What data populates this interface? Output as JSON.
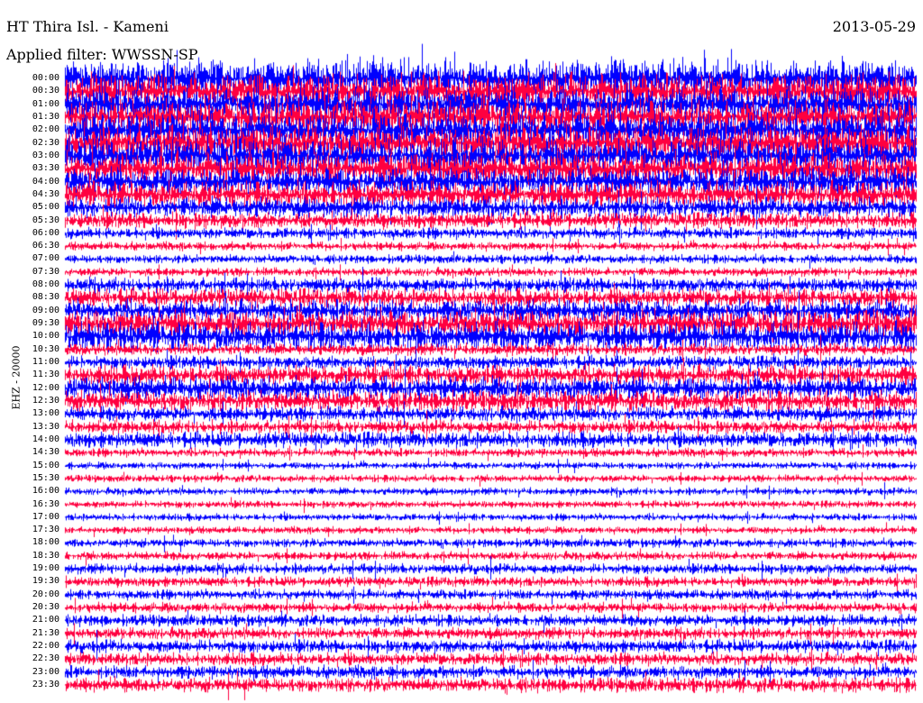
{
  "header": {
    "station": "HT Thira Isl. - Kameni",
    "filter": "Applied filter: WWSSN-SP",
    "date": "2013-05-29"
  },
  "chart_data": {
    "type": "line",
    "title": "HT Thira Isl. - Kameni",
    "ylabel": "EHZ - 20000",
    "colors": [
      "#0000ff",
      "#ff0040"
    ],
    "row_labels": [
      "00:00",
      "00:30",
      "01:00",
      "01:30",
      "02:00",
      "02:30",
      "03:00",
      "03:30",
      "04:00",
      "04:30",
      "05:00",
      "05:30",
      "06:00",
      "06:30",
      "07:00",
      "07:30",
      "08:00",
      "08:30",
      "09:00",
      "09:30",
      "10:00",
      "10:30",
      "11:00",
      "11:30",
      "12:00",
      "12:30",
      "13:00",
      "13:30",
      "14:00",
      "14:30",
      "15:00",
      "15:30",
      "16:00",
      "16:30",
      "17:00",
      "17:30",
      "18:00",
      "18:30",
      "19:00",
      "19:30",
      "20:00",
      "20:30",
      "21:00",
      "21:30",
      "22:00",
      "22:30",
      "23:00",
      "23:30"
    ],
    "row_amplitudes": [
      2.6,
      2.4,
      2.4,
      2.3,
      2.5,
      2.5,
      2.4,
      2.2,
      2.0,
      1.8,
      1.4,
      1.1,
      0.8,
      0.6,
      0.6,
      0.6,
      1.0,
      1.3,
      1.5,
      1.9,
      2.0,
      0.8,
      0.9,
      1.4,
      1.6,
      1.4,
      1.0,
      0.9,
      1.1,
      0.6,
      0.5,
      0.5,
      0.5,
      0.5,
      0.5,
      0.5,
      0.6,
      0.6,
      0.7,
      0.7,
      0.7,
      0.7,
      0.8,
      0.8,
      0.9,
      0.9,
      0.9,
      1.0
    ]
  }
}
